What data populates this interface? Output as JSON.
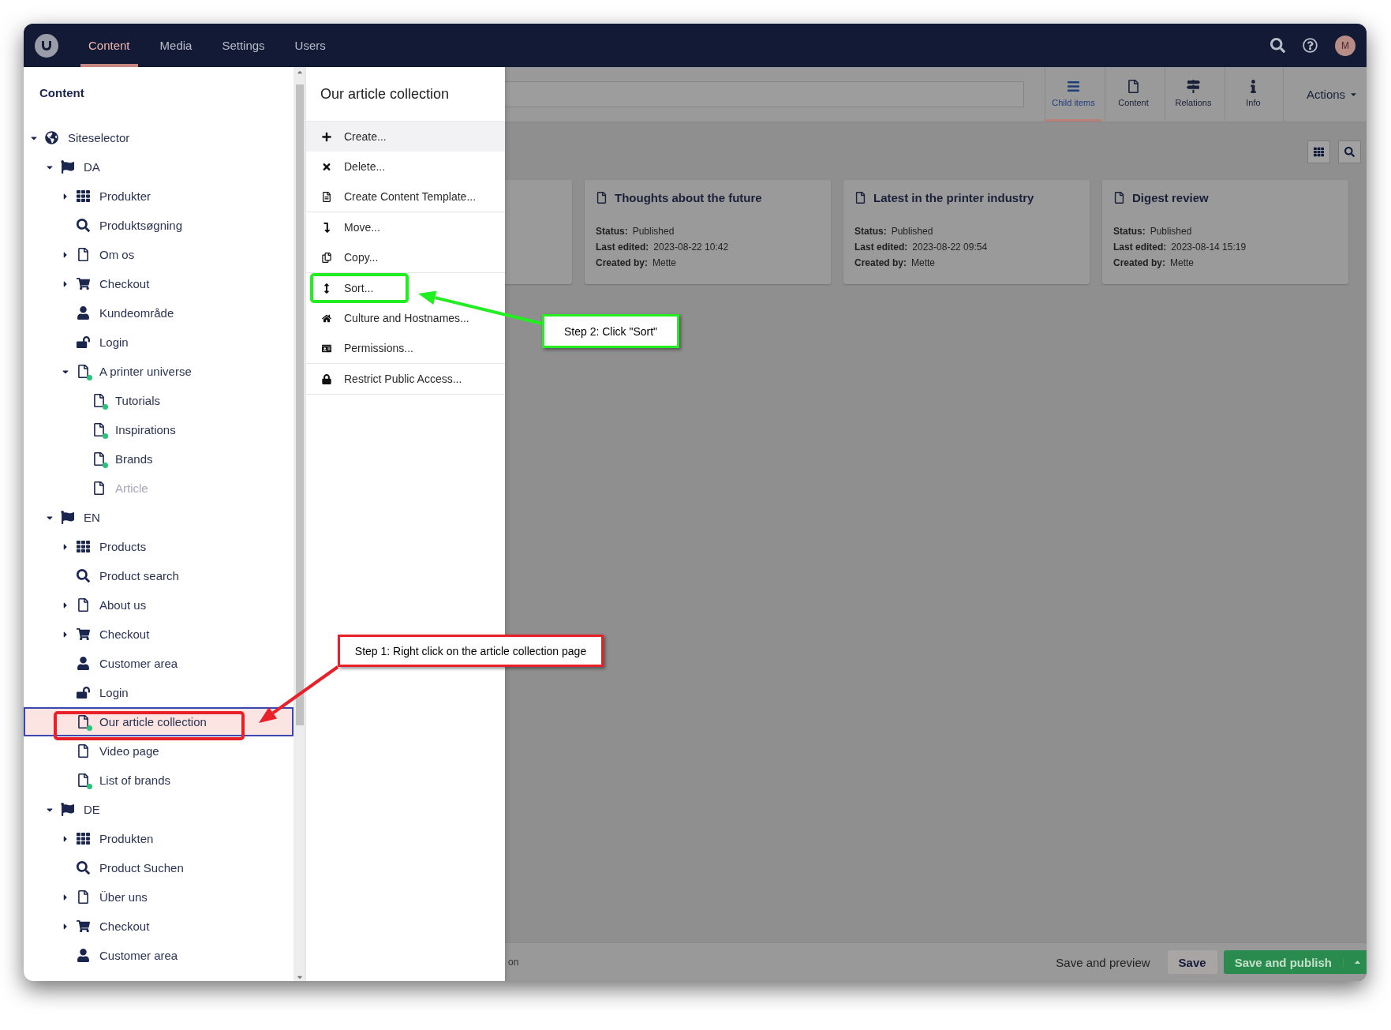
{
  "topbar": {
    "nav": [
      {
        "label": "Content",
        "selected": true
      },
      {
        "label": "Media",
        "selected": false
      },
      {
        "label": "Settings",
        "selected": false
      },
      {
        "label": "Users",
        "selected": false
      }
    ],
    "avatar": "M"
  },
  "tree": {
    "title": "Content",
    "items": [
      {
        "kind": "globe",
        "label": "Siteselector",
        "expanded": true,
        "selected": false,
        "dimmed": false,
        "children": [
          {
            "kind": "flag",
            "label": "DA",
            "expanded": true,
            "selected": false,
            "dimmed": false,
            "children": [
              {
                "kind": "grid",
                "label": "Produkter",
                "expanded": false,
                "selected": false,
                "dimmed": false
              },
              {
                "kind": "search",
                "label": "Produktsøgning",
                "selected": false,
                "dimmed": false
              },
              {
                "kind": "page",
                "label": "Om os",
                "expanded": false,
                "selected": false,
                "dimmed": false
              },
              {
                "kind": "cart",
                "label": "Checkout",
                "expanded": false,
                "selected": false,
                "dimmed": false
              },
              {
                "kind": "user",
                "label": "Kundeområde",
                "selected": false,
                "dimmed": false
              },
              {
                "kind": "unlock",
                "label": "Login",
                "selected": false,
                "dimmed": false
              },
              {
                "kind": "page-plus",
                "label": "A printer universe",
                "expanded": true,
                "selected": false,
                "dimmed": false,
                "children": [
                  {
                    "kind": "page-plus",
                    "label": "Tutorials",
                    "selected": false,
                    "dimmed": false
                  },
                  {
                    "kind": "page-plus",
                    "label": "Inspirations",
                    "selected": false,
                    "dimmed": false
                  },
                  {
                    "kind": "page-plus",
                    "label": "Brands",
                    "selected": false,
                    "dimmed": false
                  },
                  {
                    "kind": "page",
                    "label": "Article",
                    "selected": false,
                    "dimmed": true
                  }
                ]
              }
            ]
          },
          {
            "kind": "flag",
            "label": "EN",
            "expanded": true,
            "selected": false,
            "dimmed": false,
            "children": [
              {
                "kind": "grid",
                "label": "Products",
                "expanded": false,
                "selected": false,
                "dimmed": false
              },
              {
                "kind": "search",
                "label": "Product search",
                "selected": false,
                "dimmed": false
              },
              {
                "kind": "page",
                "label": "About us",
                "expanded": false,
                "selected": false,
                "dimmed": false
              },
              {
                "kind": "cart",
                "label": "Checkout",
                "expanded": false,
                "selected": false,
                "dimmed": false
              },
              {
                "kind": "user",
                "label": "Customer area",
                "selected": false,
                "dimmed": false
              },
              {
                "kind": "unlock",
                "label": "Login",
                "selected": false,
                "dimmed": false
              },
              {
                "kind": "page-plus",
                "label": "Our article collection",
                "selected": true,
                "dimmed": false
              },
              {
                "kind": "page",
                "label": "Video page",
                "selected": false,
                "dimmed": false
              },
              {
                "kind": "page-plus",
                "label": "List of brands",
                "selected": false,
                "dimmed": false
              }
            ]
          },
          {
            "kind": "flag",
            "label": "DE",
            "expanded": true,
            "selected": false,
            "dimmed": false,
            "children": [
              {
                "kind": "grid",
                "label": "Produkten",
                "expanded": false,
                "selected": false,
                "dimmed": false
              },
              {
                "kind": "search",
                "label": "Product Suchen",
                "selected": false,
                "dimmed": false
              },
              {
                "kind": "page",
                "label": "Über uns",
                "expanded": false,
                "selected": false,
                "dimmed": false
              },
              {
                "kind": "cart",
                "label": "Checkout",
                "expanded": false,
                "selected": false,
                "dimmed": false
              },
              {
                "kind": "user",
                "label": "Customer area",
                "selected": false,
                "dimmed": false
              }
            ]
          }
        ]
      }
    ]
  },
  "context_menu": {
    "title": "Our article collection",
    "groups": [
      [
        {
          "kind": "plus",
          "label": "Create...",
          "highlighted": true
        },
        {
          "kind": "cross",
          "label": "Delete...",
          "highlighted": false
        },
        {
          "kind": "template",
          "label": "Create Content Template...",
          "highlighted": false
        }
      ],
      [
        {
          "kind": "move",
          "label": "Move...",
          "highlighted": false
        },
        {
          "kind": "copy",
          "label": "Copy...",
          "highlighted": false
        }
      ],
      [
        {
          "kind": "sort",
          "label": "Sort...",
          "highlighted": false
        },
        {
          "kind": "home",
          "label": "Culture and Hostnames...",
          "highlighted": false
        },
        {
          "kind": "card",
          "label": "Permissions...",
          "highlighted": false
        }
      ],
      [
        {
          "kind": "lock",
          "label": "Restrict Public Access...",
          "highlighted": false
        }
      ]
    ]
  },
  "editor": {
    "tabs": [
      {
        "kind": "list",
        "label": "Child items",
        "selected": true
      },
      {
        "kind": "page",
        "label": "Content",
        "selected": false
      },
      {
        "kind": "signs",
        "label": "Relations",
        "selected": false
      },
      {
        "kind": "info",
        "label": "Info",
        "selected": false
      }
    ],
    "actions": "Actions",
    "cards": [
      {
        "title": "Thoughts about the future",
        "fields": [
          {
            "label": "Status:",
            "value": "Published"
          },
          {
            "label": "Last edited:",
            "value": "2023-08-22 10:42"
          },
          {
            "label": "Created by:",
            "value": "Mette"
          }
        ]
      },
      {
        "title": "Latest in the printer industry",
        "fields": [
          {
            "label": "Status:",
            "value": "Published"
          },
          {
            "label": "Last edited:",
            "value": "2023-08-22 09:54"
          },
          {
            "label": "Created by:",
            "value": "Mette"
          }
        ]
      },
      {
        "title": "Digest review",
        "fields": [
          {
            "label": "Status:",
            "value": "Published"
          },
          {
            "label": "Last edited:",
            "value": "2023-08-14 15:19"
          },
          {
            "label": "Created by:",
            "value": "Mette"
          }
        ]
      }
    ],
    "footer": {
      "breadcrumb": "on",
      "buttons": [
        {
          "kind": "link",
          "label": "Save and preview"
        },
        {
          "kind": "secondary",
          "label": "Save"
        },
        {
          "kind": "primary",
          "label": "Save and publish"
        }
      ]
    }
  },
  "annotations": [
    {
      "text": "Step 2: Click \"Sort\"",
      "color": "#22ee22"
    },
    {
      "text": "Step 1: Right click on the article collection page",
      "color": "#e8202a"
    }
  ]
}
